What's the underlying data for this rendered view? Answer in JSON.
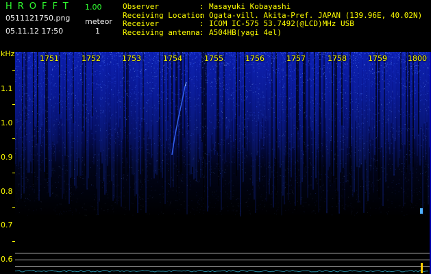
{
  "header": {
    "title": "HROFFT",
    "version": "1.00",
    "filename": "0511121750.png",
    "meteor_label": "meteor",
    "meteor_count": "1",
    "datetime": "05.11.12 17:50"
  },
  "info": [
    {
      "key": "Observer",
      "value": "Masayuki Kobayashi"
    },
    {
      "key": "Receiving Location",
      "value": "Ogata-vill. Akita-Pref. JAPAN (139.96E, 40.02N)"
    },
    {
      "key": "Receiver",
      "value": "ICOM IC-575 53.7492(@LCD)MHz USB"
    },
    {
      "key": "Receiving antenna",
      "value": "A504HB(yagi 4el)"
    }
  ],
  "axis": {
    "y_unit": "kHz",
    "y_labels": [
      "1.1",
      "1.0",
      "0.9",
      "0.8",
      "0.7",
      "0.6"
    ],
    "x_labels": [
      "1751",
      "1752",
      "1753",
      "1754",
      "1755",
      "1756",
      "1757",
      "1758",
      "1759",
      "1800"
    ]
  },
  "colors": {
    "title": "#30ff30",
    "labels": "#ffff00",
    "text": "#f4f4f4",
    "signal": "#3050ff"
  }
}
